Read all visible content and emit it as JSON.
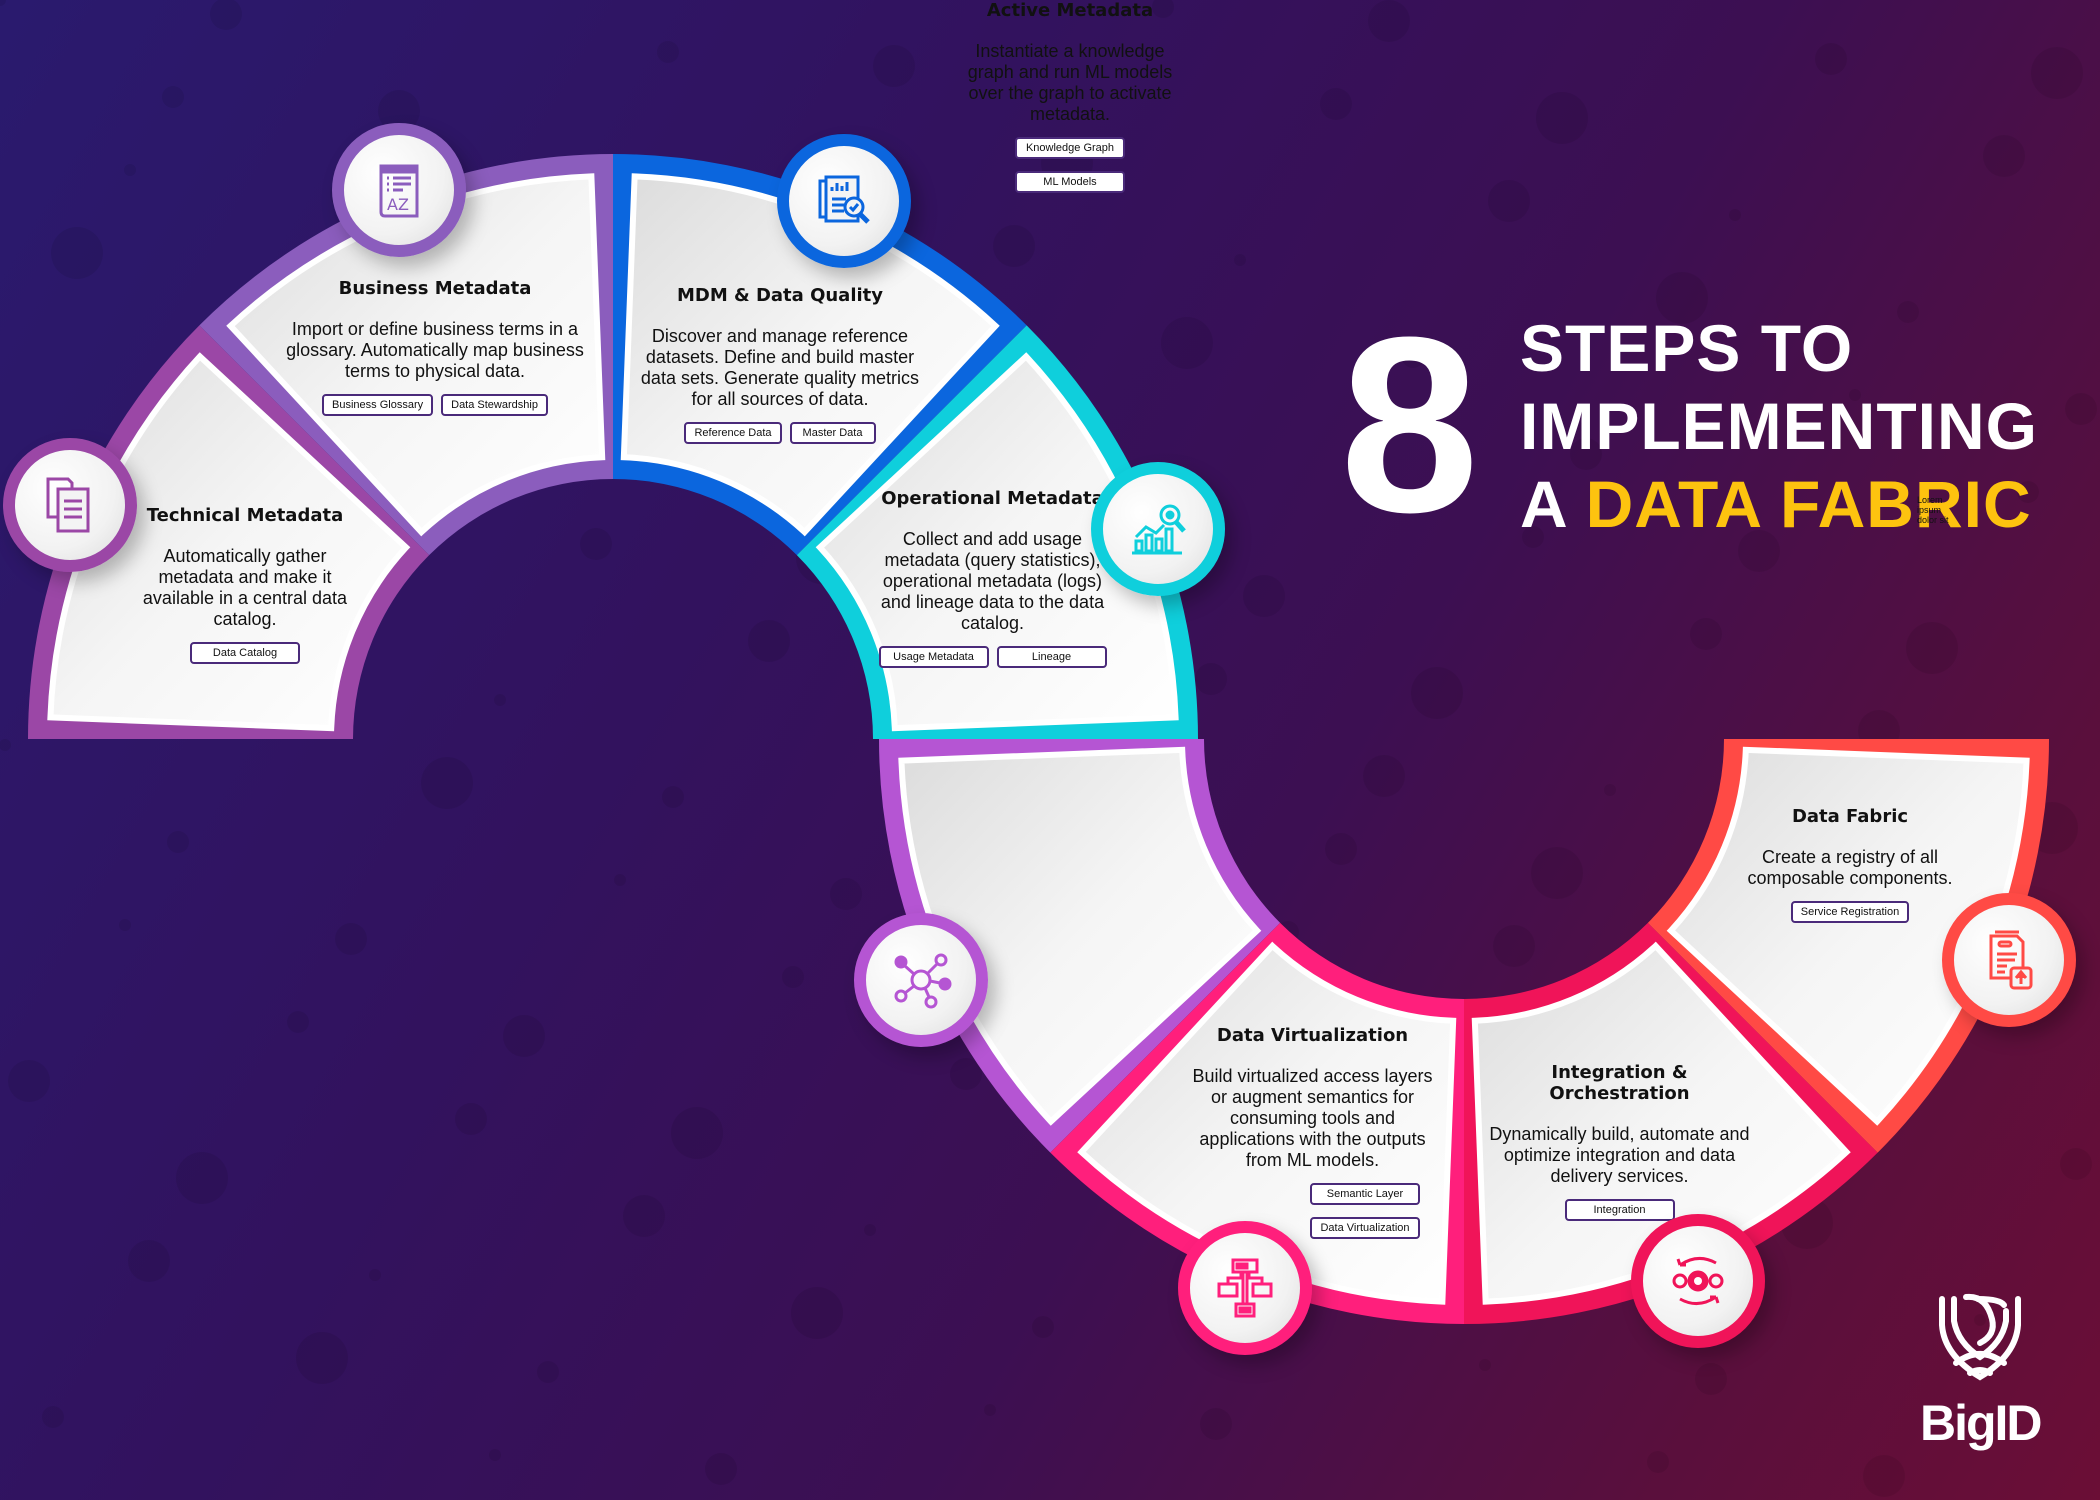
{
  "headline": {
    "number": "8",
    "line1": "STEPS TO",
    "line2": "IMPLEMENTING",
    "line3_prefix": "A ",
    "line3_accent": "DATA FABRIC",
    "stray_text": [
      "Lorem",
      "ipsum",
      "dolor sit"
    ]
  },
  "colors": {
    "background_start": "#2a1a6e",
    "background_end": "#6b0e36",
    "accent_yellow": "#FDC30F",
    "tag_border": "#4a2a7a"
  },
  "steps": [
    {
      "id": "technical-metadata",
      "title": "Technical Metadata",
      "description": "Automatically gather metadata and make it available in a central data catalog.",
      "tags": [
        "Data Catalog"
      ],
      "icon": "documents-icon",
      "color": "#9B47A6"
    },
    {
      "id": "business-metadata",
      "title": "Business Metadata",
      "description": "Import or define business terms in a glossary. Automatically map business terms to physical data.",
      "tags": [
        "Business Glossary",
        "Data Stewardship"
      ],
      "icon": "glossary-book-icon",
      "color": "#8B5DBD"
    },
    {
      "id": "mdm-data-quality",
      "title": "MDM & Data Quality",
      "description": "Discover and manage reference datasets. Define and build master data sets. Generate quality metrics for all sources of data.",
      "tags": [
        "Reference Data",
        "Master Data"
      ],
      "icon": "report-search-icon",
      "color": "#0B66DE"
    },
    {
      "id": "operational-metadata",
      "title": "Operational Metadata",
      "description": "Collect and add usage metadata (query statistics), operational metadata (logs) and lineage data to the data catalog.",
      "tags": [
        "Usage Metadata",
        "Lineage"
      ],
      "icon": "analytics-chart-icon",
      "color": "#0FCFDC"
    },
    {
      "id": "active-metadata",
      "title": "Active Metadata",
      "description": "Instantiate a knowledge graph and run ML models over the graph to activate metadata.",
      "tags": [
        "Knowledge Graph",
        "ML Models"
      ],
      "icon": "network-graph-icon",
      "color": "#B555D3"
    },
    {
      "id": "data-virtualization",
      "title": "Data Virtualization",
      "description": "Build virtualized access layers or augment semantics for consuming tools and applications with the outputs from ML models.",
      "tags": [
        "Semantic Layer",
        "Data Virtualization"
      ],
      "icon": "hierarchy-icon",
      "color": "#FF1F7C"
    },
    {
      "id": "integration-orchestration",
      "title": "Integration & Orchestration",
      "description": "Dynamically build, automate and optimize integration and data delivery services.",
      "tags": [
        "Integration"
      ],
      "icon": "gears-sync-icon",
      "color": "#F01459"
    },
    {
      "id": "data-fabric",
      "title": "Data Fabric",
      "description": "Create a registry of all composable components.",
      "tags": [
        "Service Registration"
      ],
      "icon": "document-upload-icon",
      "color": "#FF4A45"
    }
  ],
  "logo": {
    "text": "BigID",
    "icon": "fingerprint-shield-icon"
  }
}
